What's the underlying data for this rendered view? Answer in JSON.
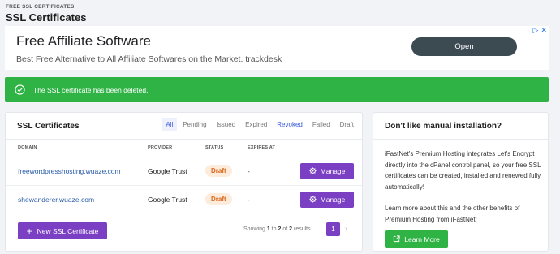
{
  "breadcrumb": "FREE SSL CERTIFICATES",
  "page_title": "SSL Certificates",
  "ad": {
    "title": "Free Affiliate Software",
    "subtitle": "Best Free Alternative to All Affiliate Softwares on the Market. trackdesk",
    "open_label": "Open",
    "adchoices_icon": "adchoices-icon",
    "close_icon": "close-icon"
  },
  "alert": {
    "message": "The SSL certificate has been deleted.",
    "icon": "check-circle-icon",
    "color": "#2fb344"
  },
  "certs": {
    "title": "SSL Certificates",
    "tabs": [
      "All",
      "Pending",
      "Issued",
      "Expired",
      "Revoked",
      "Failed",
      "Draft"
    ],
    "active_tab": "All",
    "columns": [
      "DOMAIN",
      "PROVIDER",
      "STATUS",
      "EXPIRES AT"
    ],
    "rows": [
      {
        "domain": "freewordpresshosting.wuaze.com",
        "provider": "Google Trust",
        "status": "Draft",
        "expires": "-",
        "action": "Manage"
      },
      {
        "domain": "shewanderer.wuaze.com",
        "provider": "Google Trust",
        "status": "Draft",
        "expires": "-",
        "action": "Manage"
      }
    ],
    "new_button": "New SSL Certificate",
    "pagination": {
      "prefix": "Showing",
      "from": "1",
      "to_word": "to",
      "to": "2",
      "of_word": "of",
      "total": "2",
      "suffix": "results",
      "current_page": "1"
    },
    "accent": "#7b3fc4"
  },
  "sidebar": {
    "title": "Don't like manual installation?",
    "para1": "iFastNet's Premium Hosting integrates Let's Encrypt directly into the cPanel control panel, so your free SSL certificates can be created, installed and renewed fully automatically!",
    "para2": "Learn more about this and the other benefits of Premium Hosting from iFastNet!",
    "button": "Learn More",
    "button_icon": "external-link-icon"
  }
}
